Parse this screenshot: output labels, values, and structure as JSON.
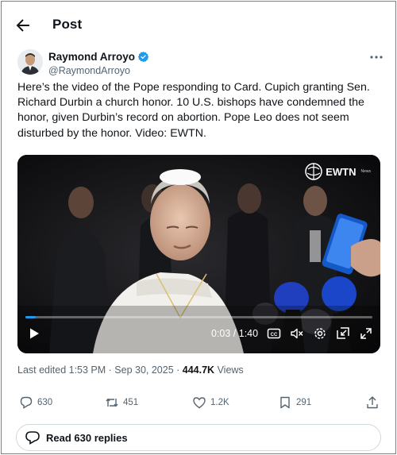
{
  "header": {
    "title": "Post"
  },
  "author": {
    "name": "Raymond Arroyo",
    "handle": "@RaymondArroyo"
  },
  "post": {
    "text": "Here’s the video of the Pope responding to Card. Cupich granting Sen. Richard Durbin a church honor. 10 U.S. bishops have condemned the honor, given Durbin’s record on abortion. Pope Leo does not seem disturbed by the honor. Video: EWTN."
  },
  "video": {
    "brand": "EWTN",
    "brand_sub": "News",
    "time": "0:03 / 1:40",
    "progress": 0.03
  },
  "meta": {
    "edited": "Last edited 1:53 PM · Sep 30, 2025 · ",
    "views": "444.7K",
    "views_label": " Views"
  },
  "actions": {
    "replies": "630",
    "reposts": "451",
    "likes": "1.2K",
    "bookmarks": "291"
  },
  "read_replies": "Read 630 replies",
  "colors": {
    "verified": "#1d9bf0",
    "muted": "#536471",
    "text": "#0f1419"
  }
}
